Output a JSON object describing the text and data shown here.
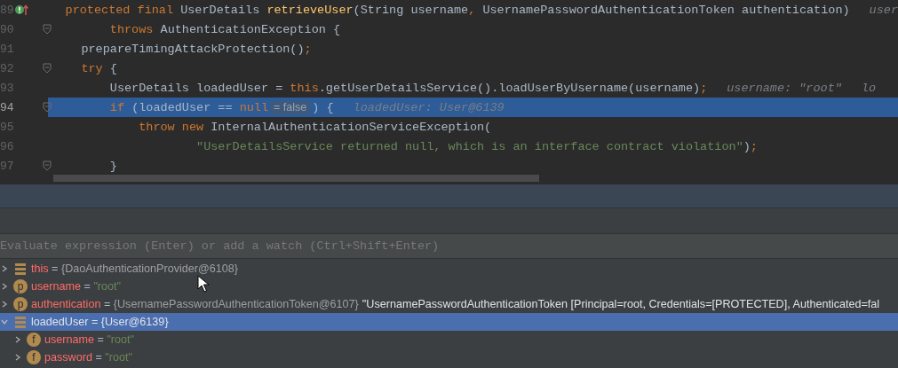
{
  "editor": {
    "lines": [
      {
        "number": "89",
        "fold": false,
        "selected": false,
        "tokens": [
          {
            "text": "    protected final ",
            "kind": "keyword"
          },
          {
            "text": "UserDetails ",
            "kind": "plain"
          },
          {
            "text": "retrieveUser",
            "kind": "method"
          },
          {
            "text": "(String username",
            "kind": "plain"
          },
          {
            "text": ", ",
            "kind": "keyword"
          },
          {
            "text": "UsernamePasswordAuthenticationToken authentication)",
            "kind": "plain"
          },
          {
            "text": "user",
            "kind": "hint"
          }
        ]
      },
      {
        "number": "90",
        "fold": true,
        "selected": false,
        "tokens": [
          {
            "text": "        throws ",
            "kind": "keyword"
          },
          {
            "text": "AuthenticationException {",
            "kind": "plain"
          }
        ]
      },
      {
        "number": "91",
        "fold": false,
        "selected": false,
        "tokens": [
          {
            "text": "    prepareTimingAttackProtection()",
            "kind": "plain"
          },
          {
            "text": ";",
            "kind": "keyword"
          }
        ]
      },
      {
        "number": "92",
        "fold": true,
        "selected": false,
        "tokens": [
          {
            "text": "    try ",
            "kind": "keyword"
          },
          {
            "text": "{",
            "kind": "plain"
          }
        ]
      },
      {
        "number": "93",
        "fold": false,
        "selected": false,
        "tokens": [
          {
            "text": "        UserDetails loadedUser = ",
            "kind": "plain"
          },
          {
            "text": "this",
            "kind": "keyword"
          },
          {
            "text": ".getUserDetailsService().loadUserByUsername(username)",
            "kind": "plain"
          },
          {
            "text": ";",
            "kind": "keyword"
          },
          {
            "text": "username: \"root\"",
            "kind": "hint"
          },
          {
            "text": "lo",
            "kind": "hint"
          }
        ]
      },
      {
        "number": "94",
        "fold": true,
        "selected": true,
        "tokens": [
          {
            "text": "        if ",
            "kind": "keyword"
          },
          {
            "text": "(loadedUser == ",
            "kind": "plain"
          },
          {
            "text": "null",
            "kind": "keyword"
          },
          {
            "text": "= false",
            "kind": "inline_value"
          },
          {
            "text": ") {",
            "kind": "plain"
          },
          {
            "text": "loadedUser: User@6139",
            "kind": "hint"
          }
        ]
      },
      {
        "number": "95",
        "fold": false,
        "selected": false,
        "tokens": [
          {
            "text": "            throw new ",
            "kind": "keyword"
          },
          {
            "text": "InternalAuthenticationServiceException(",
            "kind": "plain"
          }
        ]
      },
      {
        "number": "96",
        "fold": false,
        "selected": false,
        "tokens": [
          {
            "text": "                    \"UserDetailsService returned null, which is an interface contract violation\"",
            "kind": "string"
          },
          {
            "text": ")",
            "kind": "plain"
          },
          {
            "text": ";",
            "kind": "keyword"
          }
        ]
      },
      {
        "number": "97",
        "fold": true,
        "selected": false,
        "tokens": [
          {
            "text": "        }",
            "kind": "plain"
          }
        ]
      }
    ]
  },
  "debugger": {
    "watch_field": {
      "placeholder": "Evaluate expression (Enter) or add a watch (Ctrl+Shift+Enter)"
    },
    "variables": [
      {
        "kind": "local",
        "name": "this",
        "separator": "=",
        "value": {
          "text": "{DaoAuthenticationProvider@6108}",
          "kind": "object"
        },
        "expanded": false,
        "selected": false
      },
      {
        "kind": "param",
        "badge": "p",
        "name": "username",
        "separator": "=",
        "value": {
          "text": "\"root\"",
          "kind": "string"
        },
        "expanded": false,
        "selected": false
      },
      {
        "kind": "param",
        "badge": "p",
        "name": "authentication",
        "separator": "=",
        "value": {
          "text": "{UsernamePasswordAuthenticationToken@6107}",
          "kind": "object"
        },
        "description": "\"UsernamePasswordAuthenticationToken [Principal=root, Credentials=[PROTECTED], Authenticated=fal",
        "expanded": false,
        "selected": false
      },
      {
        "kind": "local",
        "name": "loadedUser",
        "separator": "=",
        "value": {
          "text": "{User@6139}",
          "kind": "object"
        },
        "expanded": true,
        "selected": true,
        "children": [
          {
            "kind": "field",
            "badge": "f",
            "name": "username",
            "separator": "=",
            "value": {
              "text": "\"root\"",
              "kind": "string"
            },
            "expanded": false,
            "selected": false
          },
          {
            "kind": "field",
            "badge": "f",
            "name": "password",
            "separator": "=",
            "value": {
              "text": "\"root\"",
              "kind": "string"
            },
            "expanded": false,
            "selected": false
          }
        ]
      }
    ]
  }
}
